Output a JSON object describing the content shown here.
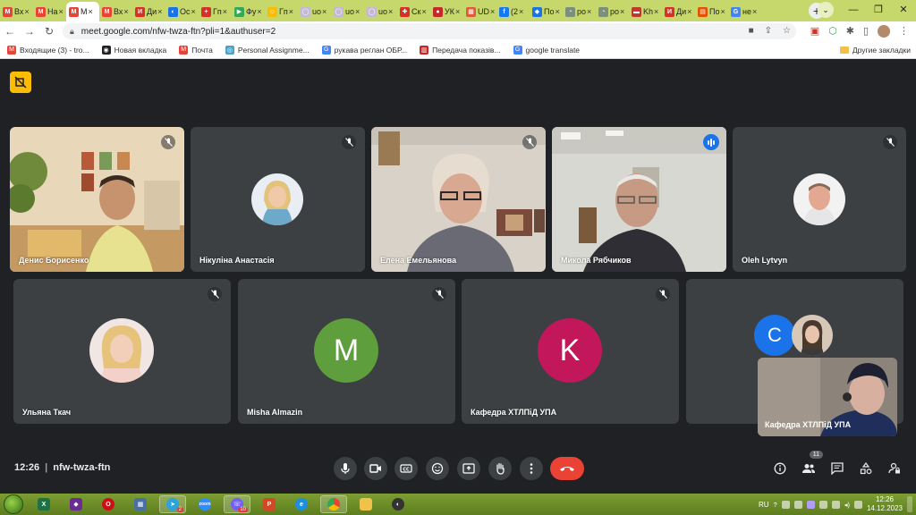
{
  "browser": {
    "tabs": [
      {
        "label": "Вх",
        "fav": "M",
        "color": "#ea4335"
      },
      {
        "label": "На",
        "fav": "M",
        "color": "#ea4335"
      },
      {
        "label": "M",
        "fav": "M",
        "color": "#ea4335",
        "active": true
      },
      {
        "label": "Вх",
        "fav": "M",
        "color": "#ea4335"
      },
      {
        "label": "Ди",
        "fav": "И",
        "color": "#d93025"
      },
      {
        "label": "Ос",
        "fav": "◐",
        "color": "#1a73e8"
      },
      {
        "label": "Гп",
        "fav": "+",
        "color": "#d93025"
      },
      {
        "label": "Фу",
        "fav": "▶",
        "color": "#34a853"
      },
      {
        "label": "Гп",
        "fav": "☺",
        "color": "#fbbc04"
      },
      {
        "label": "uo",
        "fav": "◯",
        "color": "#c6b9d6"
      },
      {
        "label": "uo",
        "fav": "◯",
        "color": "#c6b9d6"
      },
      {
        "label": "uo",
        "fav": "◯",
        "color": "#c6b9d6"
      },
      {
        "label": "Ск",
        "fav": "✚",
        "color": "#d93025"
      },
      {
        "label": "УК",
        "fav": "●",
        "color": "#c62828"
      },
      {
        "label": "UD",
        "fav": "▦",
        "color": "#e05a3a"
      },
      {
        "label": "(2",
        "fav": "f",
        "color": "#1877f2"
      },
      {
        "label": "По",
        "fav": "◆",
        "color": "#1a73e8"
      },
      {
        "label": "ро",
        "fav": "◔",
        "color": "#7c8f7a"
      },
      {
        "label": "ро",
        "fav": "◔",
        "color": "#7c8f7a"
      },
      {
        "label": "Kh",
        "fav": "▬",
        "color": "#c0392b"
      },
      {
        "label": "Ди",
        "fav": "И",
        "color": "#d93025"
      },
      {
        "label": "По",
        "fav": "▤",
        "color": "#e65100"
      },
      {
        "label": "не",
        "fav": "G",
        "color": "#4285f4"
      }
    ],
    "new_tab": "+",
    "url": "meet.google.com/nfw-twza-ftn?pli=1&authuser=2",
    "bookmarks": [
      {
        "label": "Входящие (3) - tro...",
        "icon": "gmail-icon",
        "color": "#ea4335",
        "glyph": "M"
      },
      {
        "label": "Новая вкладка",
        "icon": "globe-icon",
        "color": "#202124",
        "glyph": "◉"
      },
      {
        "label": "Почта",
        "icon": "mail-icon",
        "color": "#ea4335",
        "glyph": "M"
      },
      {
        "label": "Personal Assignme...",
        "icon": "assignment-icon",
        "color": "#4aa3c8",
        "glyph": "◎"
      },
      {
        "label": "рукава реглан ОБР...",
        "icon": "google-icon",
        "color": "#4285f4",
        "glyph": "G"
      },
      {
        "label": "Передача показів...",
        "icon": "meter-icon",
        "color": "#c62828",
        "glyph": "▥"
      },
      {
        "label": "google translate",
        "icon": "google-icon",
        "color": "#4285f4",
        "glyph": "G"
      }
    ],
    "other_bookmarks": "Другие закладки"
  },
  "meet": {
    "participants": [
      {
        "name": "Денис Борисенко",
        "kind": "video"
      },
      {
        "name": "Нікуліна Анастасія",
        "kind": "photo"
      },
      {
        "name": "Елена Емельянова",
        "kind": "video"
      },
      {
        "name": "Микола Рябчиков",
        "kind": "video",
        "speaking": true
      },
      {
        "name": "Oleh Lytvyn",
        "kind": "photo"
      },
      {
        "name": "Ульяна Ткач",
        "kind": "photo"
      },
      {
        "name": "Misha Almazin",
        "kind": "letter",
        "letter": "M",
        "color": "#5f9e3c"
      },
      {
        "name": "Кафедра ХТЛПіД УПА",
        "kind": "letter",
        "letter": "K",
        "color": "#c2185b"
      }
    ],
    "overflow_letter": "C",
    "overflow_color": "#1a73e8",
    "self_name": "Кафедра ХТЛПіД УПА",
    "time": "12:26",
    "meeting_code": "nfw-twza-ftn",
    "people_count": "11",
    "colors": {
      "hangup": "#ea4335",
      "speaker_outline": "#8ab4f8",
      "tile": "#3c4043",
      "host_badge": "#fbbc04"
    }
  },
  "taskbar": {
    "lang": "RU",
    "time": "12:26",
    "date": "14.12.2023",
    "viber_badge": "10",
    "telegram_badge": "2"
  }
}
